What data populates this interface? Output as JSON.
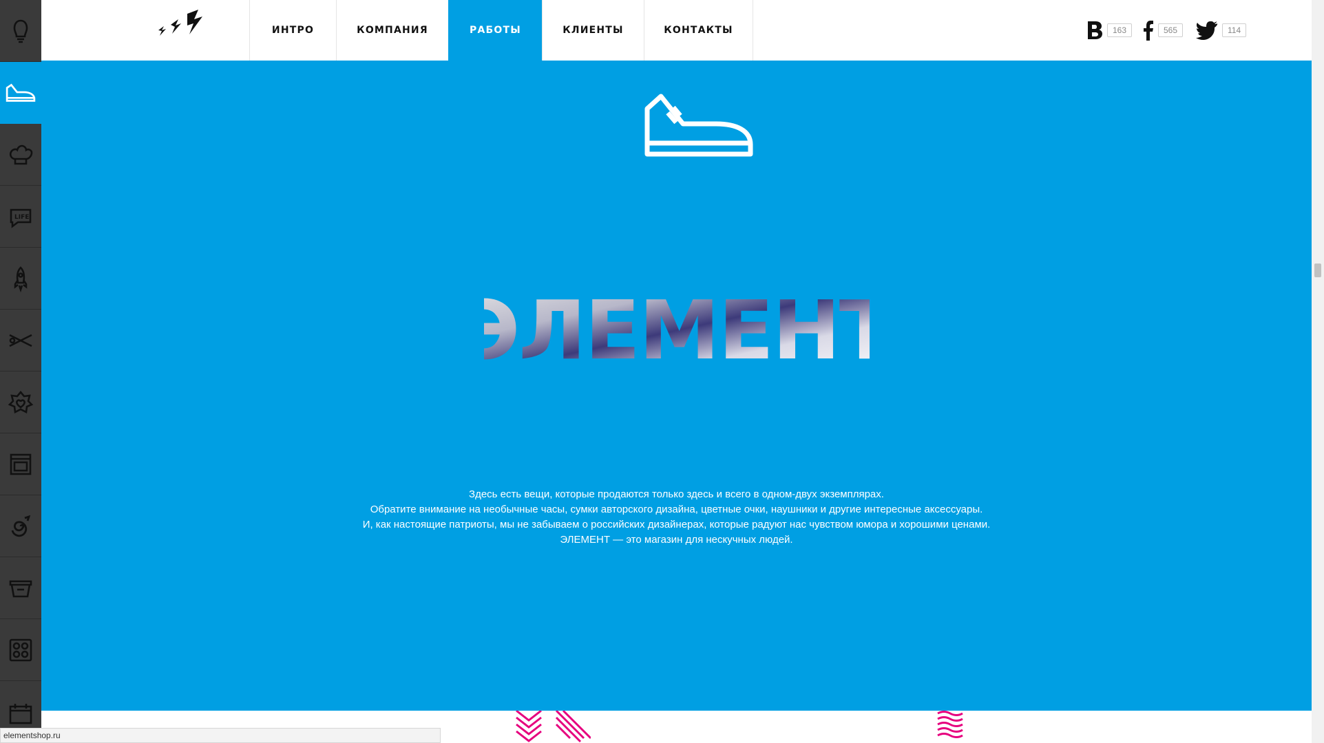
{
  "colors": {
    "accent": "#009fe3",
    "rail": "#3a3a3a",
    "pattern_pink": "#e6007e"
  },
  "sidebar": {
    "items": [
      {
        "icon": "bulb-icon"
      },
      {
        "icon": "sneaker-icon",
        "active": true
      },
      {
        "icon": "chef-hat-icon"
      },
      {
        "icon": "life-speech-bubble-icon"
      },
      {
        "icon": "rocket-icon"
      },
      {
        "icon": "scissors-icon"
      },
      {
        "icon": "flower-heart-icon"
      },
      {
        "icon": "oven-icon"
      },
      {
        "icon": "spiral-icon"
      },
      {
        "icon": "basket-icon"
      },
      {
        "icon": "grid-circles-icon"
      },
      {
        "icon": "calendar-icon"
      }
    ]
  },
  "header": {
    "logo": "lightning-bolts-logo",
    "nav": [
      {
        "label": "ИНТРО"
      },
      {
        "label": "КОМПАНИЯ"
      },
      {
        "label": "РАБОТЫ",
        "active": true
      },
      {
        "label": "КЛИЕНТЫ"
      },
      {
        "label": "КОНТАКТЫ"
      }
    ],
    "social": [
      {
        "icon": "vk-icon",
        "count": "163"
      },
      {
        "icon": "facebook-icon",
        "count": "565"
      },
      {
        "icon": "twitter-icon",
        "count": "114"
      }
    ]
  },
  "hero": {
    "icon": "sneaker-outline-icon",
    "brand_title": "ЭЛЕМЕНТ",
    "description": [
      "Здесь есть вещи, которые продаются только здесь и всего в одном-двух экземплярах.",
      "Обратите внимание на необычные часы, сумки авторского дизайна, цветные очки, наушники и другие интересные аксессуары.",
      "И, как настоящие патриоты, мы не забываем о российских дизайнерах, которые радуют нас чувством юмора и хорошими ценами.",
      "ЭЛЕМЕНТ — это магазин для нескучных людей."
    ]
  },
  "statusbar": {
    "url": "elementshop.ru"
  }
}
